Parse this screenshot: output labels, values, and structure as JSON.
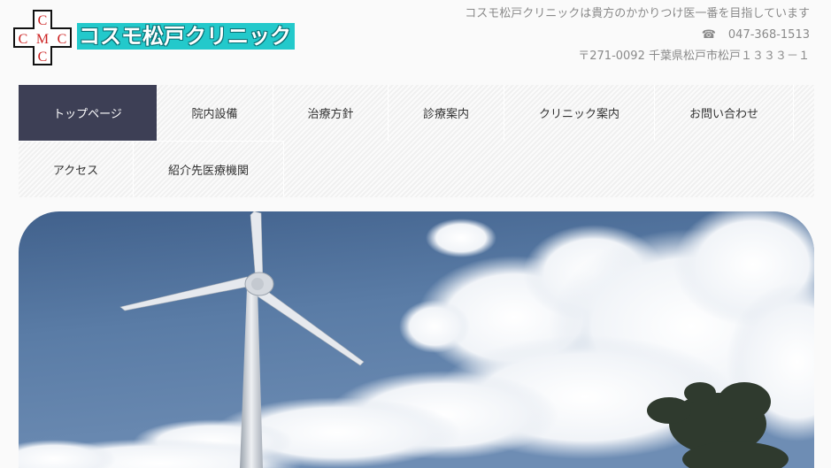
{
  "header": {
    "logo_letters": [
      "C",
      "M",
      "C",
      "C",
      "C"
    ],
    "site_name": "コスモ松戸クリニック",
    "tagline": "コスモ松戸クリニックは貴方のかかりつけ医一番を目指しています",
    "phone": "047-368-1513",
    "phone_icon": "telephone-icon",
    "address": "〒271-0092 千葉県松戸市松戸１３３３－１"
  },
  "nav": {
    "items": [
      {
        "label": "トップページ",
        "active": true
      },
      {
        "label": "院内設備"
      },
      {
        "label": "治療方針"
      },
      {
        "label": "診療案内"
      },
      {
        "label": "クリニック案内"
      },
      {
        "label": "お問い合わせ"
      },
      {
        "label": "アクセス"
      },
      {
        "label": "紹介先医療機関"
      }
    ]
  },
  "hero": {
    "image": "wind-turbine-sky-photo"
  },
  "colors": {
    "logo_bg": "#23c9cb",
    "nav_active": "#3d3f55",
    "logo_cross_letters": "#cc2222"
  }
}
